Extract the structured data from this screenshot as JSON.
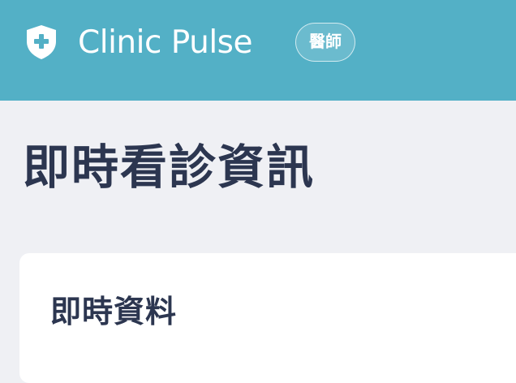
{
  "header": {
    "app_name": "Clinic Pulse",
    "role_badge": "醫師",
    "logo_icon": "shield-plus-icon",
    "background_color": "#53b0c6"
  },
  "main": {
    "page_title": "即時看診資訊",
    "card": {
      "title": "即時資料"
    }
  }
}
